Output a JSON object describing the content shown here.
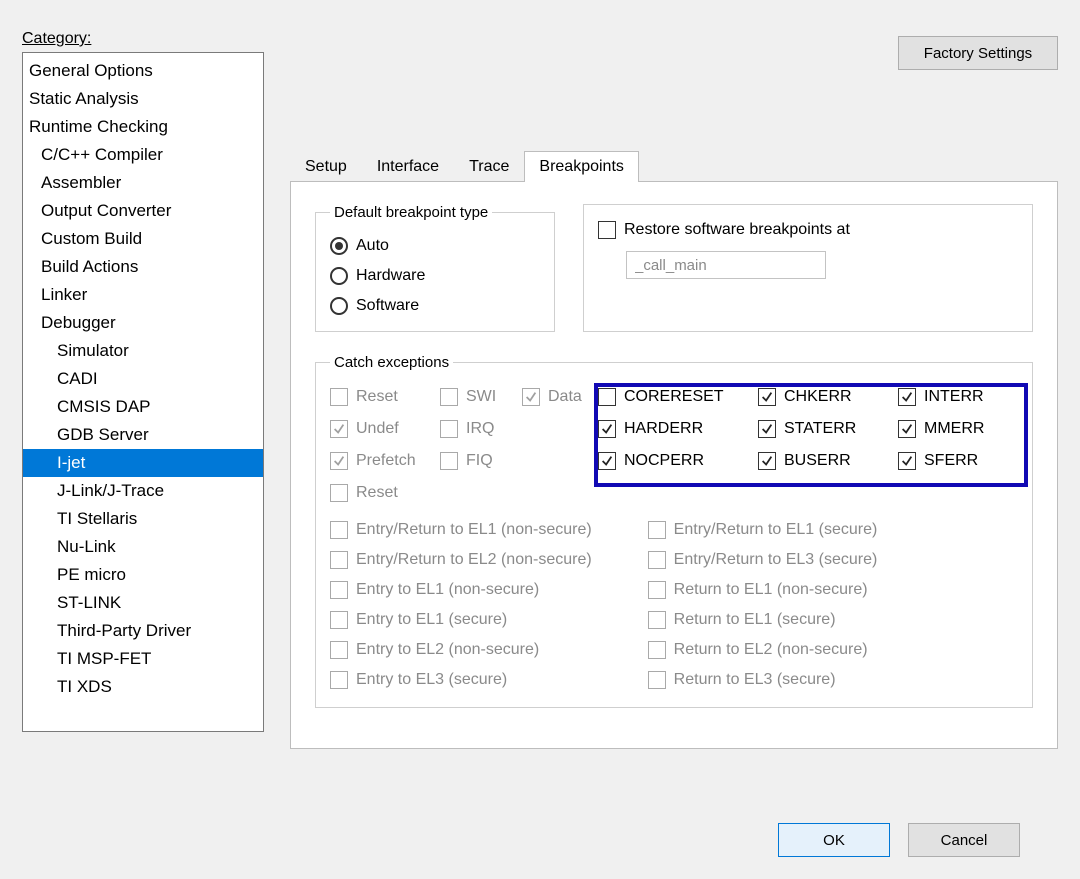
{
  "labels": {
    "category": "Category:",
    "factory": "Factory Settings",
    "ok": "OK",
    "cancel": "Cancel"
  },
  "categories": [
    {
      "label": "General Options",
      "indent": 0,
      "selected": false
    },
    {
      "label": "Static Analysis",
      "indent": 0,
      "selected": false
    },
    {
      "label": "Runtime Checking",
      "indent": 0,
      "selected": false
    },
    {
      "label": "C/C++ Compiler",
      "indent": 1,
      "selected": false
    },
    {
      "label": "Assembler",
      "indent": 1,
      "selected": false
    },
    {
      "label": "Output Converter",
      "indent": 1,
      "selected": false
    },
    {
      "label": "Custom Build",
      "indent": 1,
      "selected": false
    },
    {
      "label": "Build Actions",
      "indent": 1,
      "selected": false
    },
    {
      "label": "Linker",
      "indent": 1,
      "selected": false
    },
    {
      "label": "Debugger",
      "indent": 1,
      "selected": false
    },
    {
      "label": "Simulator",
      "indent": 2,
      "selected": false
    },
    {
      "label": "CADI",
      "indent": 2,
      "selected": false
    },
    {
      "label": "CMSIS DAP",
      "indent": 2,
      "selected": false
    },
    {
      "label": "GDB Server",
      "indent": 2,
      "selected": false
    },
    {
      "label": "I-jet",
      "indent": 2,
      "selected": true
    },
    {
      "label": "J-Link/J-Trace",
      "indent": 2,
      "selected": false
    },
    {
      "label": "TI Stellaris",
      "indent": 2,
      "selected": false
    },
    {
      "label": "Nu-Link",
      "indent": 2,
      "selected": false
    },
    {
      "label": "PE micro",
      "indent": 2,
      "selected": false
    },
    {
      "label": "ST-LINK",
      "indent": 2,
      "selected": false
    },
    {
      "label": "Third-Party Driver",
      "indent": 2,
      "selected": false
    },
    {
      "label": "TI MSP-FET",
      "indent": 2,
      "selected": false
    },
    {
      "label": "TI XDS",
      "indent": 2,
      "selected": false
    }
  ],
  "tabs": [
    {
      "label": "Setup",
      "active": false
    },
    {
      "label": "Interface",
      "active": false
    },
    {
      "label": "Trace",
      "active": false
    },
    {
      "label": "Breakpoints",
      "active": true
    }
  ],
  "bp": {
    "legend": "Default breakpoint type",
    "options": [
      "Auto",
      "Hardware",
      "Software"
    ],
    "selected": "Auto"
  },
  "restore": {
    "label": "Restore software breakpoints at",
    "checked": false,
    "value": "_call_main"
  },
  "catch": {
    "legend": "Catch exceptions",
    "col1": [
      {
        "label": "Reset",
        "checked": false,
        "disabled": true
      },
      {
        "label": "Undef",
        "checked": true,
        "disabled": true
      },
      {
        "label": "Prefetch",
        "checked": true,
        "disabled": true
      },
      {
        "label": "Reset",
        "checked": false,
        "disabled": true
      }
    ],
    "col2": [
      {
        "label": "SWI",
        "checked": false,
        "disabled": true
      },
      {
        "label": "IRQ",
        "checked": false,
        "disabled": true
      },
      {
        "label": "FIQ",
        "checked": false,
        "disabled": true
      }
    ],
    "col3": [
      {
        "label": "Data",
        "checked": true,
        "disabled": true
      }
    ],
    "errcol1": [
      {
        "label": "CORERESET",
        "checked": false,
        "disabled": false
      },
      {
        "label": "HARDERR",
        "checked": true,
        "disabled": false
      },
      {
        "label": "NOCPERR",
        "checked": true,
        "disabled": false
      }
    ],
    "errcol2": [
      {
        "label": "CHKERR",
        "checked": true,
        "disabled": false
      },
      {
        "label": "STATERR",
        "checked": true,
        "disabled": false
      },
      {
        "label": "BUSERR",
        "checked": true,
        "disabled": false
      }
    ],
    "errcol3": [
      {
        "label": "INTERR",
        "checked": true,
        "disabled": false
      },
      {
        "label": "MMERR",
        "checked": true,
        "disabled": false
      },
      {
        "label": "SFERR",
        "checked": true,
        "disabled": false
      }
    ],
    "el_left": [
      {
        "label": "Entry/Return to EL1 (non-secure)"
      },
      {
        "label": "Entry/Return to EL2 (non-secure)"
      },
      {
        "label": "Entry to EL1 (non-secure)"
      },
      {
        "label": "Entry to EL1 (secure)"
      },
      {
        "label": "Entry to EL2 (non-secure)"
      },
      {
        "label": "Entry to EL3 (secure)"
      }
    ],
    "el_right": [
      {
        "label": "Entry/Return to EL1 (secure)"
      },
      {
        "label": "Entry/Return to EL3 (secure)"
      },
      {
        "label": "Return to EL1 (non-secure)"
      },
      {
        "label": "Return to EL1 (secure)"
      },
      {
        "label": "Return to EL2 (non-secure)"
      },
      {
        "label": "Return to EL3 (secure)"
      }
    ]
  }
}
